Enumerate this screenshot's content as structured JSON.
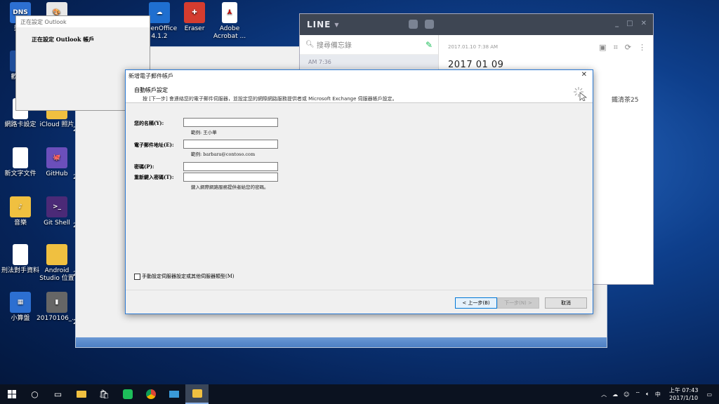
{
  "desktop": {
    "icons": [
      {
        "id": "dns",
        "label": "變更",
        "color": "#2c6fd1",
        "glyph": "DNS"
      },
      {
        "id": "paint",
        "label": "",
        "color": "#e8e8e8",
        "glyph": "🎨"
      },
      {
        "id": "openoffice",
        "label": "OpenOffice 4.1.2",
        "color": "#1f6fd0",
        "glyph": "☁"
      },
      {
        "id": "eraser",
        "label": "Eraser",
        "color": "#d43c2f",
        "glyph": "✚"
      },
      {
        "id": "acrobat",
        "label": "Adobe Acrobat ...",
        "color": "#ffffff",
        "glyph": "⅄"
      },
      {
        "id": "network-sync",
        "label": "歡迎使",
        "color": "#1e4d9a",
        "glyph": "A"
      },
      {
        "id": "kodi",
        "label": "",
        "color": "#1dc0e6",
        "glyph": "K"
      },
      {
        "id": "app-blue",
        "label": "",
        "color": "#1e88e5",
        "glyph": "➤"
      },
      {
        "id": "acrobat2",
        "label": "",
        "color": "#7a0000",
        "glyph": "⅄"
      },
      {
        "id": "netcard",
        "label": "網路卡設定",
        "color": "#ffffff",
        "glyph": ""
      },
      {
        "id": "icloud",
        "label": "iCloud 照片",
        "color": "#f0c040",
        "glyph": ""
      },
      {
        "id": "newtext",
        "label": "新文字文件",
        "color": "#ffffff",
        "glyph": ""
      },
      {
        "id": "github",
        "label": "GitHub",
        "color": "#6b4fbb",
        "glyph": "🐙"
      },
      {
        "id": "music",
        "label": "音樂",
        "color": "#f0c040",
        "glyph": "♪"
      },
      {
        "id": "gitshell",
        "label": "Git Shell",
        "color": "#4b2a77",
        "glyph": ">_"
      },
      {
        "id": "criminal",
        "label": "刑法對手資料",
        "color": "#ffffff",
        "glyph": ""
      },
      {
        "id": "android-studio",
        "label": "Android Studio 位置",
        "color": "#f0c040",
        "glyph": ""
      },
      {
        "id": "calculator",
        "label": "小算盤",
        "color": "#2c6fd1",
        "glyph": "▦"
      },
      {
        "id": "file-20170106",
        "label": "20170106_...",
        "color": "#666666",
        "glyph": "▮"
      }
    ],
    "side_chars": [
      "2",
      "2",
      "2",
      "2",
      "2",
      "2"
    ]
  },
  "outlook_setup": {
    "title": "正在設定 Outlook",
    "message": "正在設定 Outlook 帳戶"
  },
  "line": {
    "brand": "LINE",
    "search_placeholder": "搜尋備忘錄",
    "memo_time": "AM 7:36",
    "note_timestamp": "2017.01.10 7:38 AM",
    "note_title": "2017 01 09",
    "note_text": "鐵清茶25"
  },
  "dialog": {
    "title": "新增電子郵件帳戶",
    "header_title": "自動帳戶設定",
    "header_desc": "按 [下一步] 會連絡您的電子郵件伺服器，並設定您的網際網路服務提供者或 Microsoft Exchange 伺服器帳戶設定。",
    "name_label": "您的名稱(Y):",
    "name_value": "",
    "name_example": "範例: 王小華",
    "email_label": "電子郵件地址(E):",
    "email_value": "",
    "email_example": "範例: barbara@contoso.com",
    "password_label": "密碼(P):",
    "password_value": "",
    "confirm_label": "重新鍵入密碼(T):",
    "confirm_value": "",
    "password_hint": "鍵入網際網路服務提供者給您的密碼。",
    "manual_label": "手動設定伺服器設定或其他伺服器類型(M)",
    "back_label": "< 上一步(B)",
    "next_label": "下一步(N) >",
    "cancel_label": "取消"
  },
  "taskbar": {
    "time": "上午 07:43",
    "date": "2017/1/10",
    "ime": "中"
  }
}
